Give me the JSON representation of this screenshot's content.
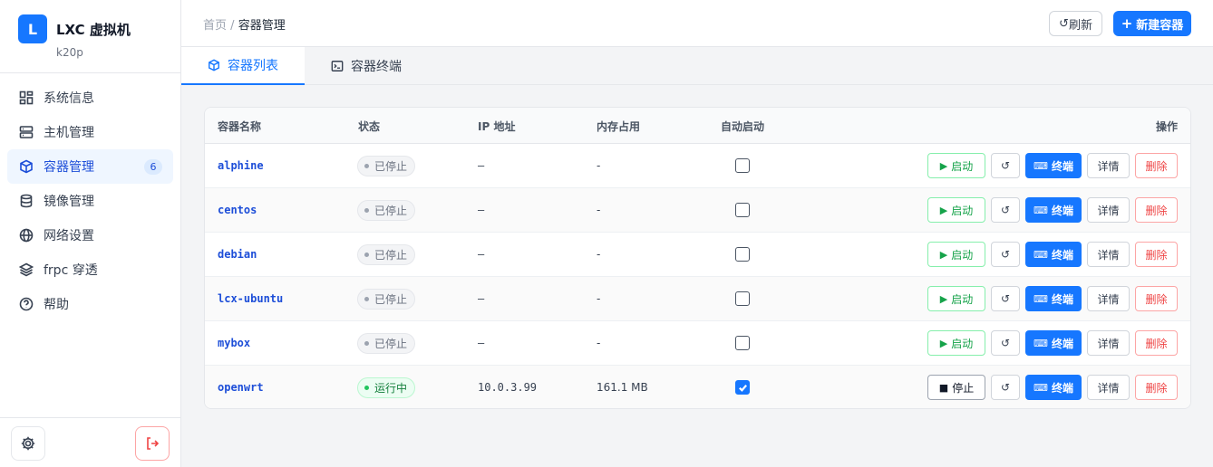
{
  "brand": {
    "logo": "L",
    "title": "LXC 虚拟机",
    "host": "k20p"
  },
  "nav": [
    {
      "label": "系统信息",
      "icon": "dashboard-icon"
    },
    {
      "label": "主机管理",
      "icon": "server-icon"
    },
    {
      "label": "容器管理",
      "icon": "box-icon",
      "badge": "6",
      "active": true
    },
    {
      "label": "镜像管理",
      "icon": "database-icon"
    },
    {
      "label": "网络设置",
      "icon": "globe-icon"
    },
    {
      "label": "frpc 穿透",
      "icon": "layers-icon"
    },
    {
      "label": "帮助",
      "icon": "help-icon"
    }
  ],
  "header": {
    "breadcrumb_home": "首页",
    "breadcrumb_sep": "/",
    "breadcrumb_current": "容器管理",
    "refresh_label": "刷新",
    "refresh_icon": "↺",
    "new_label": "新建容器",
    "new_icon": "+"
  },
  "tabs": [
    {
      "label": "容器列表",
      "icon": "box-icon",
      "active": true
    },
    {
      "label": "容器终端",
      "icon": "terminal-icon"
    }
  ],
  "table": {
    "columns": [
      "容器名称",
      "状态",
      "IP 地址",
      "内存占用",
      "自动启动",
      "操作"
    ],
    "actions": {
      "start": "启动",
      "stop": "停止",
      "restart": "↺",
      "terminal": "终端",
      "detail": "详情",
      "delete": "删除",
      "start_icon": "▶",
      "stop_icon": "■",
      "terminal_icon": "⌨"
    },
    "rows": [
      {
        "name": "alphine",
        "status": "已停止",
        "running": false,
        "ip": "–",
        "mem": "-",
        "autostart": false
      },
      {
        "name": "centos",
        "status": "已停止",
        "running": false,
        "ip": "–",
        "mem": "-",
        "autostart": false
      },
      {
        "name": "debian",
        "status": "已停止",
        "running": false,
        "ip": "–",
        "mem": "-",
        "autostart": false
      },
      {
        "name": "lcx-ubuntu",
        "status": "已停止",
        "running": false,
        "ip": "–",
        "mem": "-",
        "autostart": false
      },
      {
        "name": "mybox",
        "status": "已停止",
        "running": false,
        "ip": "–",
        "mem": "-",
        "autostart": false
      },
      {
        "name": "openwrt",
        "status": "运行中",
        "running": true,
        "ip": "10.0.3.99",
        "mem": "161.1 MB",
        "autostart": true
      }
    ]
  },
  "colors": {
    "accent": "#1677ff",
    "running": "#16a34a",
    "danger": "#ef4444"
  }
}
